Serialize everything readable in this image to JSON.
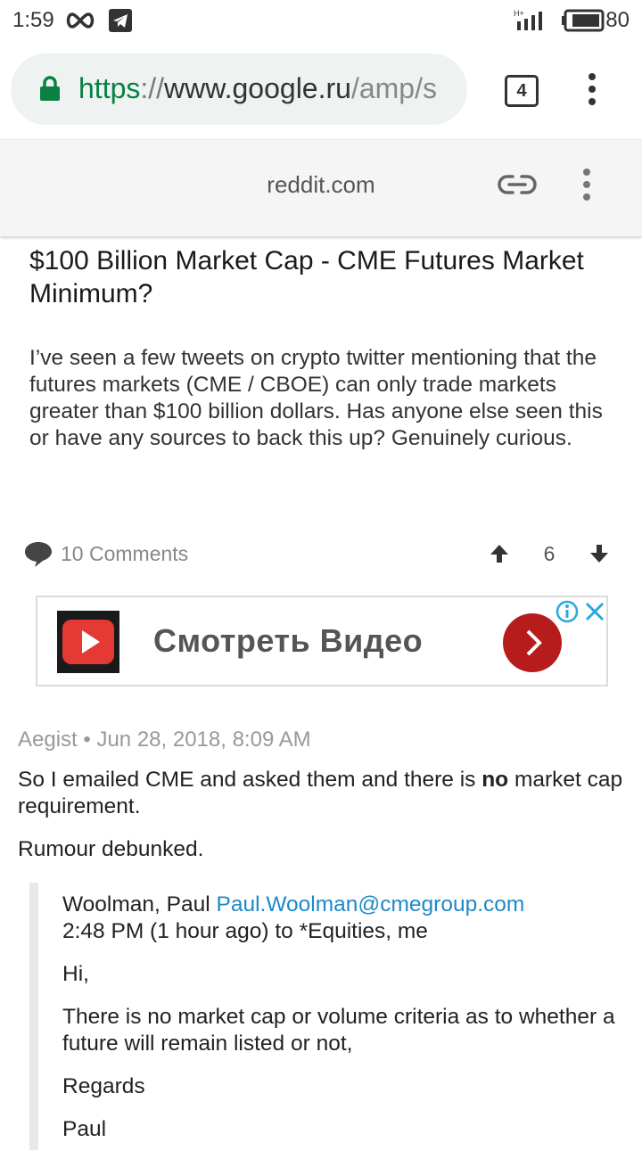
{
  "status_bar": {
    "time": "1:59",
    "battery": "80",
    "network": "H+"
  },
  "browser": {
    "url_scheme": "https",
    "url_sep": "://",
    "url_host": "www.google.ru",
    "url_path": "/amp/s",
    "tab_count": "4"
  },
  "amp_header": {
    "domain": "reddit.com"
  },
  "post": {
    "title": "$100 Billion Market Cap - CME Futures Market Minimum?",
    "body": "I’ve seen a few tweets on crypto twitter mentioning that the futures markets (CME / CBOE) can only trade markets greater than $100 billion dollars. Has anyone else seen this or have any sources to back this up? Genuinely curious.",
    "comments_label": "10 Comments",
    "score": "6"
  },
  "ad": {
    "text": "Смотреть Видео"
  },
  "comment": {
    "author": "Aegist",
    "dot": "•",
    "timestamp": "Jun 28, 2018, 8:09 AM",
    "line1_before": "So I emailed CME and asked them and there is ",
    "line1_bold": "no",
    "line1_after": " market cap requirement.",
    "line2": "Rumour debunked.",
    "quote": {
      "sender": "Woolman, Paul",
      "email": "Paul.Woolman@cmegroup.com",
      "sent_line": "2:48 PM (1 hour ago) to *Equities, me",
      "greeting": "Hi,",
      "body": "There is no market cap or volume criteria as to whether a future will remain listed or not,",
      "closing": "Regards",
      "signature": "Paul"
    }
  },
  "colors": {
    "secure_green": "#0b8043",
    "link_blue": "#1e88c8",
    "ad_red": "#b71c1c",
    "meta_grey": "#999999"
  }
}
